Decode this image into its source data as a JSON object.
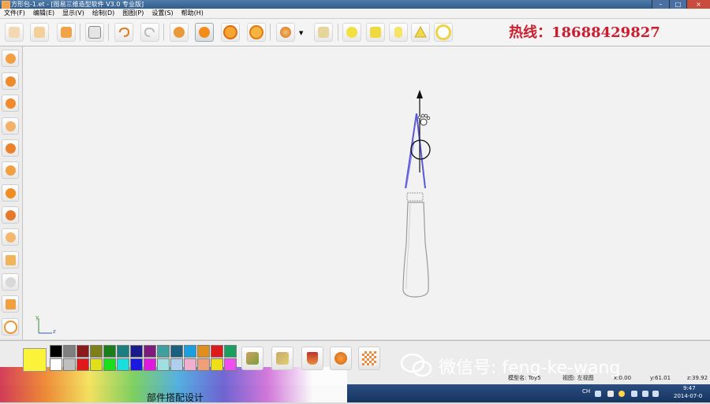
{
  "window": {
    "title": "方形包-1.et - [图易三维造型软件 V3.0 专业版]"
  },
  "menu": [
    "文件(F)",
    "编辑(E)",
    "显示(V)",
    "绘制(D)",
    "图图(P)",
    "设置(S)",
    "帮助(H)"
  ],
  "toolbar": {
    "icons": [
      "new-file-icon",
      "open-book-icon",
      "open-folder-icon",
      "print-preview-icon",
      "undo-icon",
      "redo-icon",
      "move-icon",
      "paw-select-icon",
      "zoom-in-icon",
      "zoom-out-icon",
      "render-sphere-icon",
      "dropdown-arrow-icon",
      "view-options-icon",
      "sphere-primitive-icon",
      "cube-primitive-icon",
      "cylinder-primitive-icon",
      "cone-primitive-icon",
      "torus-primitive-icon"
    ]
  },
  "hotline": "热线：18688429827",
  "left_tools": [
    "magic-wand-icon",
    "bowl-icon",
    "ellipse-icon",
    "cone-tool-icon",
    "gear-tool-icon",
    "lathe-icon",
    "pie-icon",
    "disc-icon",
    "wave-icon",
    "grid-icon",
    "butterfly-icon",
    "bracket-icon",
    "loop-icon"
  ],
  "axes": {
    "y": "y",
    "x": "z"
  },
  "palette": {
    "current": "#fbf23a",
    "colors": [
      "#000000",
      "#7f7f7f",
      "#8b1a1a",
      "#7f7f1a",
      "#1a7f1a",
      "#1a7f7f",
      "#1a1a8b",
      "#7f1a7f",
      "#3f9f9f",
      "#1a5f7f",
      "#1a9fdf",
      "#df8f1a",
      "#df1a1a",
      "#1a9f5f",
      "#ffffff",
      "#bfbfbf",
      "#df1a1a",
      "#dfdf1a",
      "#1adf1a",
      "#1adfdf",
      "#1a1adf",
      "#df1adf",
      "#9fdfdf",
      "#afcfef",
      "#efafcf",
      "#efa07a",
      "#efdf1a",
      "#ef4fef"
    ]
  },
  "brush_tools": [
    "brush-icon",
    "airbrush-icon",
    "fill-cup-icon",
    "ice-cream-icon",
    "checker-texture-icon"
  ],
  "caption": "部件搭配设计",
  "watermark": "微信号: feng-ke-wang",
  "status": {
    "model_name": "模型名: Toy5",
    "view": "视图: 左视图",
    "x": "x:0.00",
    "y": "y:61.01",
    "z": "z:39.92"
  },
  "taskbar": {
    "ime": "CH",
    "time": "9:47",
    "date": "2014-07-0"
  }
}
